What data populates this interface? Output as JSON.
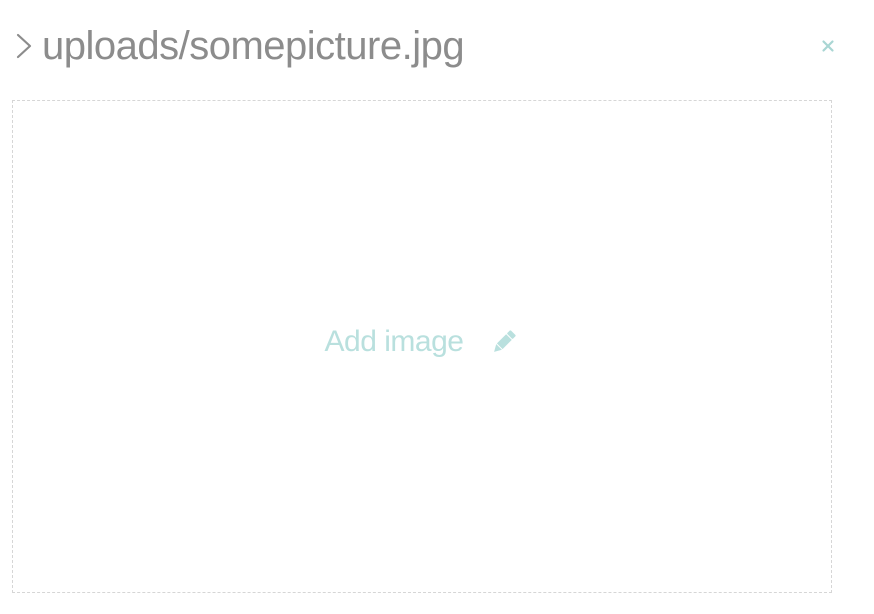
{
  "header": {
    "title": "uploads/somepicture.jpg",
    "chevron_icon": "chevron-right-icon",
    "close_icon": "close-icon"
  },
  "dropzone": {
    "label": "Add image",
    "icon": "pencil-icon"
  },
  "colors": {
    "title": "#8c8c8c",
    "accent": "#b9e0de",
    "close": "#a9d6d3",
    "border": "#d6d6d6"
  }
}
